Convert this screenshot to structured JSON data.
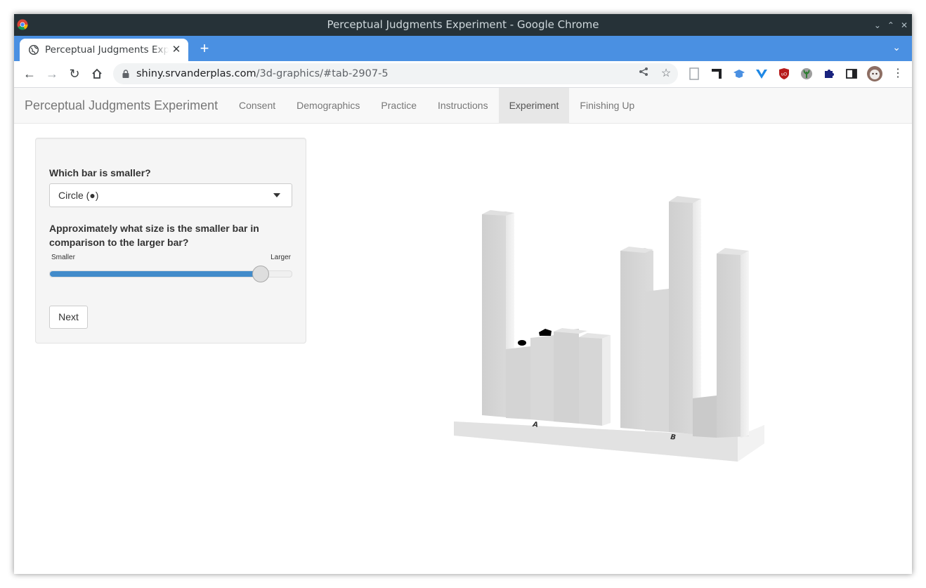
{
  "window": {
    "title": "Perceptual Judgments Experiment - Google Chrome",
    "controls": [
      "⌄",
      "⌃",
      "✕"
    ]
  },
  "tab": {
    "title": "Perceptual Judgments Experiment - Google Chrome",
    "close": "✕",
    "new_tab": "+"
  },
  "toolbar": {
    "url_host": "shiny.srvanderplas.com",
    "url_path": "/3d-graphics/#tab-2907-5"
  },
  "app": {
    "brand": "Perceptual Judgments Experiment",
    "nav": [
      "Consent",
      "Demographics",
      "Practice",
      "Instructions",
      "Experiment",
      "Finishing Up"
    ],
    "active_nav": "Experiment"
  },
  "form": {
    "question1": "Which bar is smaller?",
    "select_value": "Circle (●)",
    "question2": "Approximately what size is the smaller bar in comparison to the larger bar?",
    "slider_min_label": "Smaller",
    "slider_max_label": "Larger",
    "slider_value_fraction": 0.87,
    "next_label": "Next"
  },
  "scene": {
    "base_labels": [
      "A",
      "B"
    ]
  }
}
